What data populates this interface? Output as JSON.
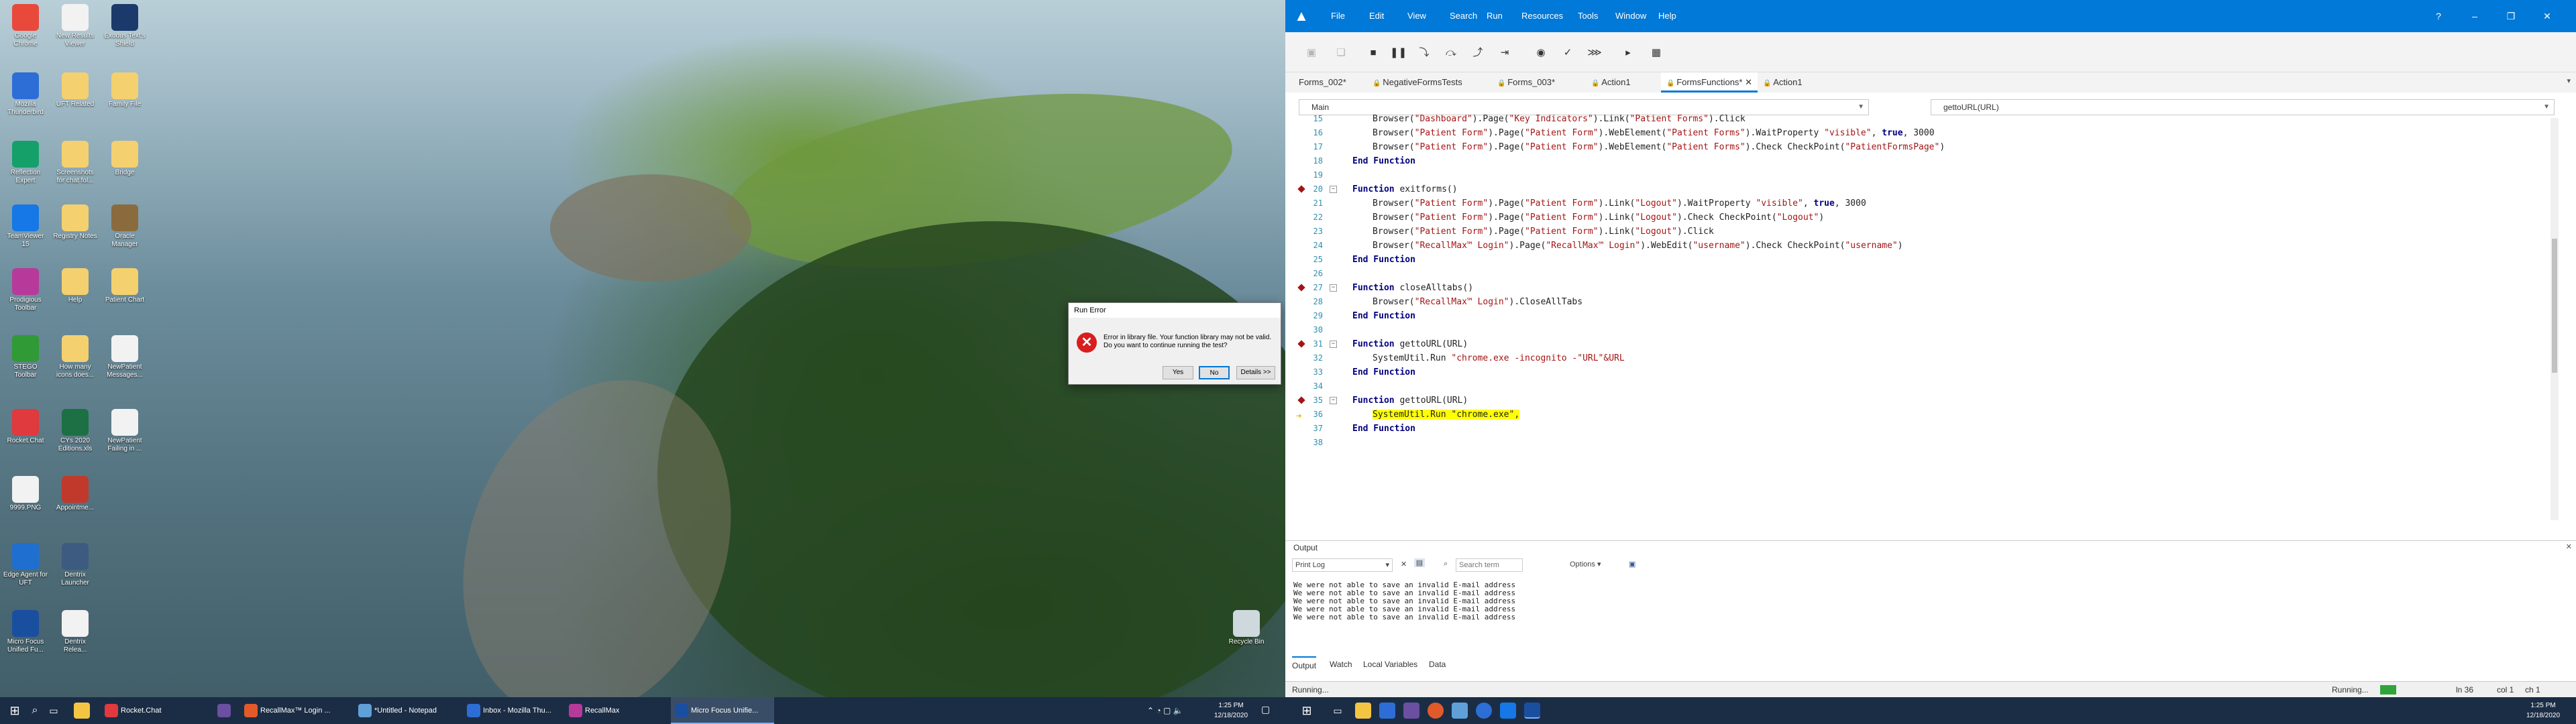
{
  "desktop": {
    "icons": [
      {
        "label": "Google Chrome",
        "color": "#e8493b"
      },
      {
        "label": "New Results Viewer",
        "color": "#f2f2f2"
      },
      {
        "label": "Exodus Text's Shield",
        "color": "#1b3a6b"
      },
      {
        "label": "Mozilla Thunderbird",
        "color": "#2d6ed6"
      },
      {
        "label": "UFT Related",
        "color": "#f4d06f"
      },
      {
        "label": "Family File",
        "color": "#f4d06f"
      },
      {
        "label": "Reflection Expert",
        "color": "#15a06a"
      },
      {
        "label": "Screenshots for chat fol...",
        "color": "#f4d06f"
      },
      {
        "label": "Bridge",
        "color": "#f4d06f"
      },
      {
        "label": "TeamViewer 15",
        "color": "#1677e6"
      },
      {
        "label": "Registry Notes",
        "color": "#f4d06f"
      },
      {
        "label": "Oracle Manager",
        "color": "#8a6b3e"
      },
      {
        "label": "Prodigious Toolbar",
        "color": "#b73a9b"
      },
      {
        "label": "Help",
        "color": "#f4d06f"
      },
      {
        "label": "Patient Chart",
        "color": "#f4d06f"
      },
      {
        "label": "STEGO Toolbar",
        "color": "#2f9a36"
      },
      {
        "label": "How many icons does...",
        "color": "#f4d06f"
      },
      {
        "label": "NewPatient Messages...",
        "color": "#f2f2f2"
      },
      {
        "label": "Rocket.Chat",
        "color": "#e0393e"
      },
      {
        "label": "CYs 2020 Editions.xls",
        "color": "#1d7044"
      },
      {
        "label": "NewPatient Failing in ...",
        "color": "#f2f2f2"
      },
      {
        "label": "9999.PNG",
        "color": "#f2f2f2"
      },
      {
        "label": "Appointme...",
        "color": "#c0392b"
      },
      {
        "label": "Edge Agent for UFT",
        "color": "#1f6fd1"
      },
      {
        "label": "Dentrix Launcher",
        "color": "#3d5a80"
      },
      {
        "label": "Micro Focus Unified Fu...",
        "color": "#1a4fa0"
      },
      {
        "label": "Dentrix Relea...",
        "color": "#f2f2f2"
      },
      {
        "label": "Recycle Bin",
        "color": "#cfd8dc"
      }
    ]
  },
  "dialog": {
    "title": "Run Error",
    "message": "Error in library file. Your function library may not be valid. Do you want to continue running the test?",
    "yes": "Yes",
    "no": "No",
    "details": "Details >>"
  },
  "taskbar_left": {
    "apps": [
      {
        "label": "Rocket.Chat",
        "color": "#e0393e"
      },
      {
        "label": "",
        "color": "#6b4fa0"
      },
      {
        "label": "RecallMax™ Login ...",
        "color": "#e25a2a"
      },
      {
        "label": "*Untitled - Notepad",
        "color": "#5fa0d9"
      },
      {
        "label": "Inbox - Mozilla Thu...",
        "color": "#2d6ed6"
      },
      {
        "label": "RecallMax",
        "color": "#b73a9b"
      },
      {
        "label": "Micro Focus Unifie...",
        "color": "#1a4fa0"
      }
    ],
    "time": "1:25 PM",
    "date": "12/18/2020"
  },
  "ide": {
    "menu": [
      "File",
      "Edit",
      "View",
      "Search",
      "Run",
      "Resources",
      "Tools",
      "Window",
      "Help"
    ],
    "tabs": [
      "Forms_002*",
      "NegativeFormsTests",
      "Forms_003*",
      "Action1",
      "FormsFunctions*",
      "Action1"
    ],
    "active_tab": "FormsFunctions*",
    "scope": "Main",
    "function_select": "gettoURL(URL)",
    "output": {
      "title": "Output",
      "mode": "Print Log",
      "search_placeholder": "Search term",
      "options": "Options",
      "lines": [
        "We were not able to save an invalid E-mail address",
        "We were not able to save an invalid E-mail address",
        "We were not able to save an invalid E-mail address",
        "We were not able to save an invalid E-mail address",
        "We were not able to save an invalid E-mail address"
      ],
      "tabs": [
        "Output",
        "Watch",
        "Local Variables",
        "Data"
      ]
    },
    "status": {
      "left": "Running...",
      "state": "Running...",
      "line": "ln 36",
      "col": "col 1",
      "ch": "ch 1"
    }
  },
  "code": [
    {
      "n": "15",
      "parts": [
        [
          "i",
          "Browser("
        ],
        [
          "s",
          "\"Dashboard\""
        ],
        [
          "i",
          ").Page("
        ],
        [
          "s",
          "\"Key Indicators\""
        ],
        [
          "i",
          ").Link("
        ],
        [
          "s",
          "\"Patient Forms\""
        ],
        [
          "i",
          ").Click"
        ]
      ]
    },
    {
      "n": "16",
      "parts": [
        [
          "i",
          "Browser("
        ],
        [
          "s",
          "\"Patient Form\""
        ],
        [
          "i",
          ").Page("
        ],
        [
          "s",
          "\"Patient Form\""
        ],
        [
          "i",
          ").WebElement("
        ],
        [
          "s",
          "\"Patient Forms\""
        ],
        [
          "i",
          ").WaitProperty "
        ],
        [
          "s",
          "\"visible\""
        ],
        [
          "i",
          ", "
        ],
        [
          "k",
          "true"
        ],
        [
          "i",
          ", 3000"
        ]
      ]
    },
    {
      "n": "17",
      "parts": [
        [
          "i",
          "Browser("
        ],
        [
          "s",
          "\"Patient Form\""
        ],
        [
          "i",
          ").Page("
        ],
        [
          "s",
          "\"Patient Form\""
        ],
        [
          "i",
          ").WebElement("
        ],
        [
          "s",
          "\"Patient Forms\""
        ],
        [
          "i",
          ").Check CheckPoint("
        ],
        [
          "s",
          "\"PatientFormsPage\""
        ],
        [
          "i",
          ")"
        ]
      ]
    },
    {
      "n": "18",
      "parts": [
        [
          "k",
          "End Function"
        ]
      ]
    },
    {
      "n": "19",
      "parts": []
    },
    {
      "n": "20",
      "parts": [
        [
          "k",
          "Function"
        ],
        [
          "i",
          " exitforms()"
        ]
      ]
    },
    {
      "n": "21",
      "parts": [
        [
          "i",
          "Browser("
        ],
        [
          "s",
          "\"Patient Form\""
        ],
        [
          "i",
          ").Page("
        ],
        [
          "s",
          "\"Patient Form\""
        ],
        [
          "i",
          ").Link("
        ],
        [
          "s",
          "\"Logout\""
        ],
        [
          "i",
          ").WaitProperty "
        ],
        [
          "s",
          "\"visible\""
        ],
        [
          "i",
          ", "
        ],
        [
          "k",
          "true"
        ],
        [
          "i",
          ", 3000"
        ]
      ]
    },
    {
      "n": "22",
      "parts": [
        [
          "i",
          "Browser("
        ],
        [
          "s",
          "\"Patient Form\""
        ],
        [
          "i",
          ").Page("
        ],
        [
          "s",
          "\"Patient Form\""
        ],
        [
          "i",
          ").Link("
        ],
        [
          "s",
          "\"Logout\""
        ],
        [
          "i",
          ").Check CheckPoint("
        ],
        [
          "s",
          "\"Logout\""
        ],
        [
          "i",
          ")"
        ]
      ]
    },
    {
      "n": "23",
      "parts": [
        [
          "i",
          "Browser("
        ],
        [
          "s",
          "\"Patient Form\""
        ],
        [
          "i",
          ").Page("
        ],
        [
          "s",
          "\"Patient Form\""
        ],
        [
          "i",
          ").Link("
        ],
        [
          "s",
          "\"Logout\""
        ],
        [
          "i",
          ").Click"
        ]
      ]
    },
    {
      "n": "24",
      "parts": [
        [
          "i",
          "Browser("
        ],
        [
          "s",
          "\"RecallMax™ Login\""
        ],
        [
          "i",
          ").Page("
        ],
        [
          "s",
          "\"RecallMax™ Login\""
        ],
        [
          "i",
          ").WebEdit("
        ],
        [
          "s",
          "\"username\""
        ],
        [
          "i",
          ").Check CheckPoint("
        ],
        [
          "s",
          "\"username\""
        ],
        [
          "i",
          ")"
        ]
      ]
    },
    {
      "n": "25",
      "parts": [
        [
          "k",
          "End Function"
        ]
      ]
    },
    {
      "n": "26",
      "parts": []
    },
    {
      "n": "27",
      "parts": [
        [
          "k",
          "Function"
        ],
        [
          "i",
          " closeAlltabs()"
        ]
      ]
    },
    {
      "n": "28",
      "parts": [
        [
          "i",
          "Browser("
        ],
        [
          "s",
          "\"RecallMax™ Login\""
        ],
        [
          "i",
          ").CloseAllTabs"
        ]
      ]
    },
    {
      "n": "29",
      "parts": [
        [
          "k",
          "End Function"
        ]
      ]
    },
    {
      "n": "30",
      "parts": []
    },
    {
      "n": "31",
      "parts": [
        [
          "k",
          "Function"
        ],
        [
          "i",
          " gettoURL(URL)"
        ]
      ]
    },
    {
      "n": "32",
      "parts": [
        [
          "i",
          "SystemUtil.Run "
        ],
        [
          "s",
          "\"chrome.exe -incognito -\"URL\"&URL"
        ]
      ]
    },
    {
      "n": "33",
      "parts": [
        [
          "k",
          "End Function"
        ]
      ]
    },
    {
      "n": "34",
      "parts": []
    },
    {
      "n": "35",
      "parts": [
        [
          "k",
          "Function"
        ],
        [
          "i",
          " gettoURL(URL)"
        ]
      ]
    },
    {
      "n": "36",
      "parts": [
        [
          "h",
          "SystemUtil.Run \"chrome.exe\","
        ]
      ]
    },
    {
      "n": "37",
      "parts": [
        [
          "k",
          "End Function"
        ]
      ]
    },
    {
      "n": "38",
      "parts": []
    }
  ]
}
